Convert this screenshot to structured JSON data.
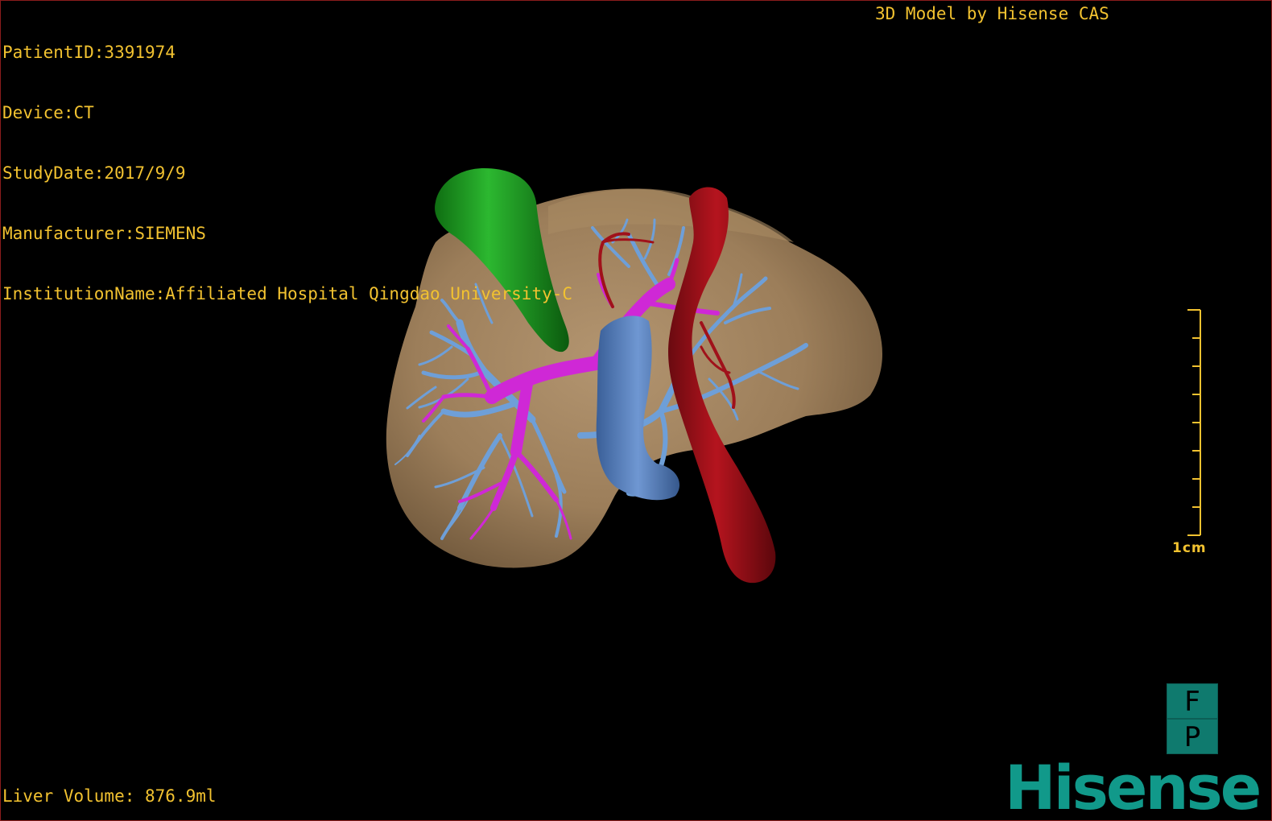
{
  "overlay": {
    "patient_id": "PatientID:3391974",
    "device": "Device:CT",
    "study_date": "StudyDate:2017/9/9",
    "manufacturer": "Manufacturer:SIEMENS",
    "institution": "InstitutionName:Affiliated Hospital Qingdao University-C",
    "credit": "3D Model by Hisense CAS",
    "liver_volume": "Liver Volume: 876.9ml"
  },
  "scale": {
    "label": "1cm"
  },
  "orientation": {
    "top": "F",
    "bottom": "P"
  },
  "brand": {
    "logo_text": "Hisense"
  },
  "colors": {
    "overlay_text": "#f2c230",
    "liver": "#9c7e5a",
    "gallbladder": "#1f9a24",
    "hepatic_veins": "#6e9fd8",
    "portal_vein": "#cf28d6",
    "vena_cava": "#5782c2",
    "aorta": "#a0111a",
    "brand_teal": "#11998a"
  }
}
